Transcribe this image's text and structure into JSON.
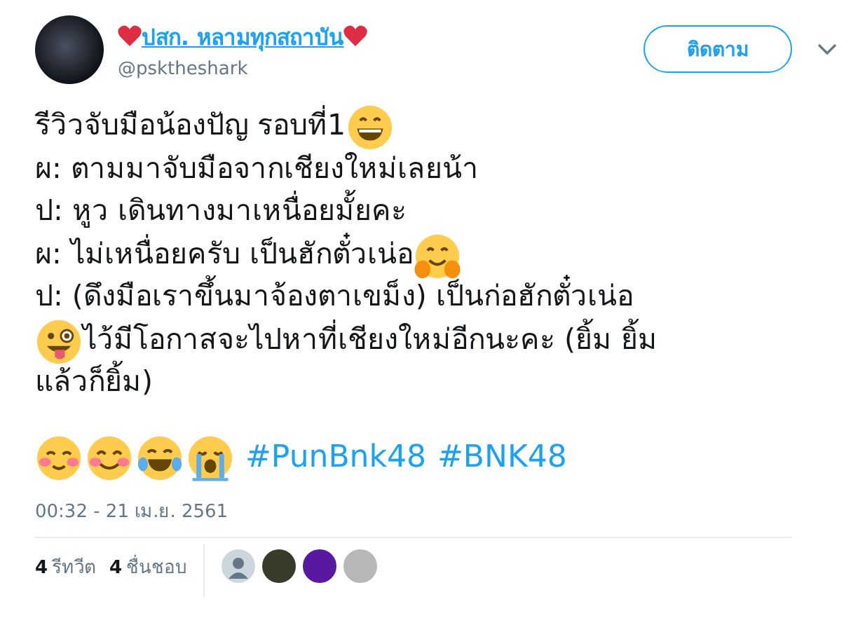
{
  "author": {
    "name": "ปสก. หลามทุกสถาบัน",
    "handle": "@psktheshark",
    "follow_button": "ติดตาม"
  },
  "tweet": {
    "lines": [
      [
        {
          "kind": "text",
          "text": "รีวิวจับมือน้องปัญ รอบที่1 "
        },
        {
          "kind": "grin"
        }
      ],
      [
        {
          "kind": "text",
          "text": "ผ: ตามมาจับมือจากเชียงใหม่เลยน้า"
        }
      ],
      [
        {
          "kind": "text",
          "text": "ป: หูว เดินทางมาเหนื่อยมั้ยคะ"
        }
      ],
      [
        {
          "kind": "text",
          "text": "ผ: ไม่เหนื่อยครับ เป็นฮักตั๋วเน่อ"
        },
        {
          "kind": "hug"
        }
      ],
      [
        {
          "kind": "text",
          "text": "ป: (ดึงมือเราขึ้นมาจ้องตาเขม็ง) เป็นก่อฮักตั๋วเน่อ"
        }
      ],
      [
        {
          "kind": "wink"
        },
        {
          "kind": "text",
          "text": " ไว้มีโอกาสจะไปหาที่เชียงใหม่อีกนะคะ (ยิ้ม ยิ้ม"
        }
      ],
      [
        {
          "kind": "text",
          "text": "แล้วก็ยิ้ม)"
        }
      ]
    ],
    "last_line": [
      {
        "kind": "blush"
      },
      {
        "kind": "smile"
      },
      {
        "kind": "laugh"
      },
      {
        "kind": "cry"
      },
      {
        "kind": "hashtag",
        "text": "#PunBnk48"
      },
      {
        "kind": "hashtag",
        "text": "#BNK48"
      }
    ],
    "timestamp": "00:32 - 21 เม.ย. 2561"
  },
  "stats": [
    {
      "count": "4",
      "label": "รีทวีต"
    },
    {
      "count": "4",
      "label": "ชื่นชอบ"
    }
  ],
  "likers": [
    {
      "kind": "silhouette"
    },
    {
      "kind": "photo"
    },
    {
      "kind": "photo"
    },
    {
      "kind": "photo"
    }
  ]
}
